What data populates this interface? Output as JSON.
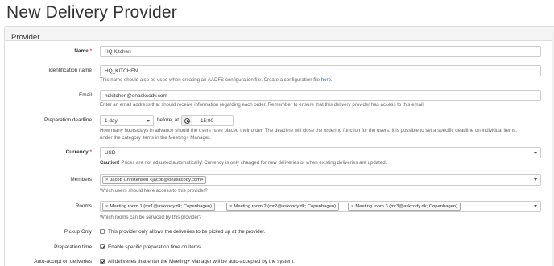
{
  "page": {
    "title": "New Delivery Provider"
  },
  "panel": {
    "heading": "Provider"
  },
  "name": {
    "label": "Name",
    "required": "*",
    "value": "HQ Kitchen"
  },
  "identification": {
    "label": "Identification name",
    "value": "HQ_KITCHEN",
    "help_text": "This name should also be used when creating an AADFS configuration file. Create a configuration file ",
    "help_link": "here",
    "help_end": "."
  },
  "email": {
    "label": "Email",
    "value": "hqkitchen@onaskcody.com",
    "help": "Enter an email address that should receive information regarding each order. Remember to ensure that this delivery provider has access to this email."
  },
  "deadline": {
    "label": "Preparation deadline",
    "days_value": "1 day",
    "before_text": "before, at",
    "time_value": "15:00",
    "help_line1": "How many hours/days in advance should the users have placed their order. The deadline will close the ordering function for the users. It is possible to set a specific deadline on individual items,",
    "help_line2": "under the category items in the Meeting+ Manager."
  },
  "currency": {
    "label": "Currency",
    "required": "*",
    "value": "USD",
    "caution_bold": "Caution!",
    "caution_text": " Prices are not adjusted automatically! Currency is only changed for new deliveries or when existing deliveries are updated."
  },
  "members": {
    "label": "Members",
    "tags": [
      "Jacob Christensen <jacob@onaskcody.com>"
    ],
    "help": "Which users should have access to this provider?"
  },
  "rooms": {
    "label": "Rooms",
    "tags": [
      "Meeting room 1 (mr1@askcody.dk; Copenhagen)",
      "Meeting room 2 (mr2@askcody.dk; Copenhagen)",
      "Meeting room 3 (mr3@askcody.dk; Copenhagen)"
    ],
    "help": "Which rooms can be serviced by this provider?"
  },
  "pickup": {
    "label": "Pickup Only",
    "checked": false,
    "text": "This provider only allows the deliveries to be picked up at the provider."
  },
  "prep_time": {
    "label": "Preparation time",
    "checked": true,
    "text": "Enable specific preparation time on items."
  },
  "auto_accept": {
    "label": "Auto-accept on deliveries",
    "checked": true,
    "text": "All deliveries that enter the Meeting+ Manager will be auto-accepted by the system."
  },
  "tag_remove": "×"
}
